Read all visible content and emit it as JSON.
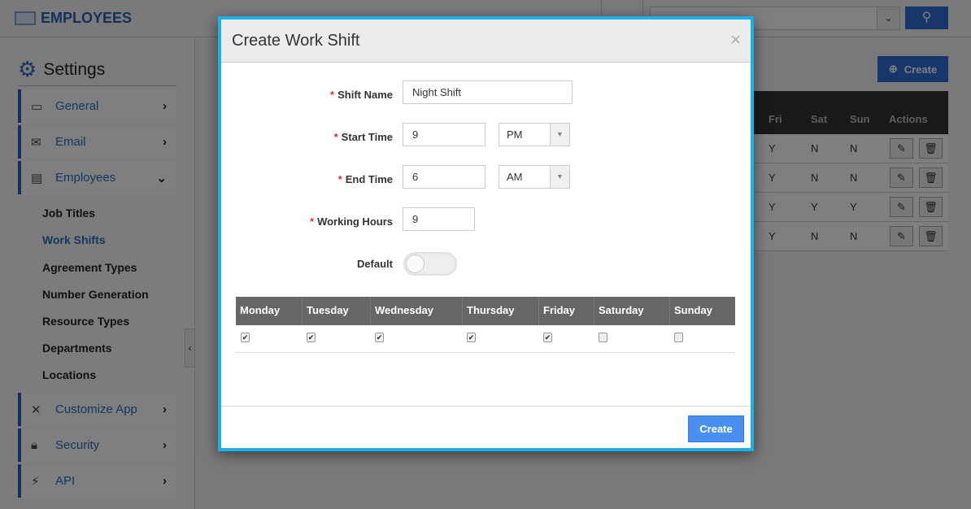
{
  "app": {
    "title": "EMPLOYEES"
  },
  "sidebar": {
    "heading": "Settings",
    "items": [
      {
        "label": "General",
        "icon": "monitor-icon"
      },
      {
        "label": "Email",
        "icon": "envelope-icon"
      },
      {
        "label": "Employees",
        "icon": "id-card-icon"
      },
      {
        "label": "Customize App",
        "icon": "tools-icon"
      },
      {
        "label": "Security",
        "icon": "lock-icon"
      },
      {
        "label": "API",
        "icon": "plug-icon"
      }
    ],
    "subitems": [
      "Job Titles",
      "Work Shifts",
      "Agreement Types",
      "Number Generation",
      "Resource Types",
      "Departments",
      "Locations"
    ],
    "active_subitem": "Work Shifts"
  },
  "background": {
    "create_label": "Create",
    "table": {
      "headers": [
        "Fri",
        "Sat",
        "Sun",
        "Actions"
      ],
      "rows": [
        [
          "Y",
          "N",
          "N"
        ],
        [
          "Y",
          "N",
          "N"
        ],
        [
          "Y",
          "Y",
          "Y"
        ],
        [
          "Y",
          "N",
          "N"
        ]
      ]
    }
  },
  "modal": {
    "title": "Create Work Shift",
    "close": "×",
    "fields": {
      "shift_name": {
        "label": "Shift Name",
        "value": "Night Shift"
      },
      "start_time": {
        "label": "Start Time",
        "value": "9",
        "period": "PM"
      },
      "end_time": {
        "label": "End Time",
        "value": "6",
        "period": "AM"
      },
      "working_hours": {
        "label": "Working Hours",
        "value": "9"
      },
      "default": {
        "label": "Default",
        "on": false
      }
    },
    "days": [
      {
        "label": "Monday",
        "checked": true
      },
      {
        "label": "Tuesday",
        "checked": true
      },
      {
        "label": "Wednesday",
        "checked": true
      },
      {
        "label": "Thursday",
        "checked": true
      },
      {
        "label": "Friday",
        "checked": true
      },
      {
        "label": "Saturday",
        "checked": false
      },
      {
        "label": "Sunday",
        "checked": false
      }
    ],
    "create_label": "Create"
  },
  "colors": {
    "accent": "#2f6fd6",
    "modal_border": "#1eaee8",
    "create_button": "#4a8ff0"
  }
}
